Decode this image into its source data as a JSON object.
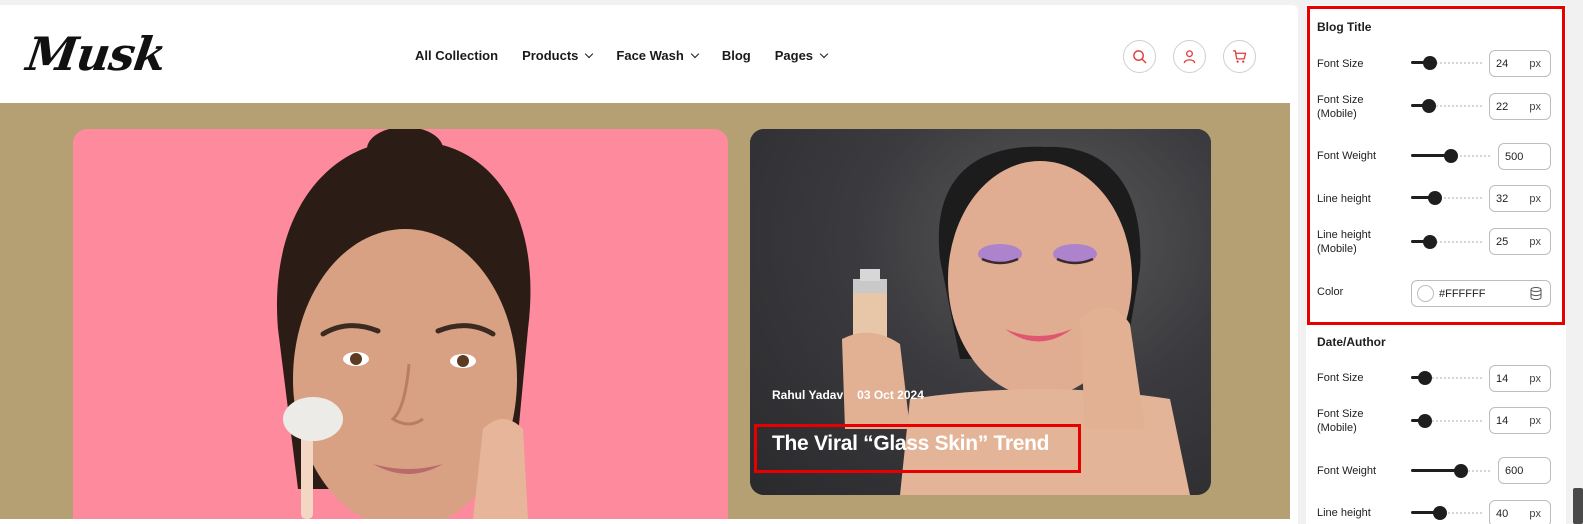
{
  "site": {
    "logo": "Musk",
    "nav": [
      {
        "label": "All Collection",
        "has_dropdown": false
      },
      {
        "label": "Products",
        "has_dropdown": true
      },
      {
        "label": "Face Wash",
        "has_dropdown": true
      },
      {
        "label": "Blog",
        "has_dropdown": false
      },
      {
        "label": "Pages",
        "has_dropdown": true
      }
    ],
    "header_icons": [
      "search-icon",
      "user-icon",
      "cart-icon"
    ],
    "icon_color": "#e03c3c"
  },
  "blog": {
    "featured_post": {
      "author": "Rahul Yadav",
      "date": "03 Oct 2024",
      "title": "The Viral “Glass Skin” Trend"
    },
    "band_color": "#b5a074",
    "card1_color": "#fe8a9d"
  },
  "settings": {
    "blog_title": {
      "heading": "Blog Title",
      "font_size": {
        "label": "Font Size",
        "value": "24",
        "unit": "px",
        "level": 0.27
      },
      "font_size_mobile": {
        "label": "Font Size (Mobile)",
        "value": "22",
        "unit": "px",
        "level": 0.25
      },
      "font_weight": {
        "label": "Font Weight",
        "value": "500",
        "level": 0.5
      },
      "line_height": {
        "label": "Line height",
        "value": "32",
        "unit": "px",
        "level": 0.33
      },
      "line_height_mobile": {
        "label": "Line height (Mobile)",
        "value": "25",
        "unit": "px",
        "level": 0.27
      },
      "color": {
        "label": "Color",
        "value": "#FFFFFF"
      }
    },
    "date_author": {
      "heading": "Date/Author",
      "font_size": {
        "label": "Font Size",
        "value": "14",
        "unit": "px",
        "level": 0.19
      },
      "font_size_mobile": {
        "label": "Font Size (Mobile)",
        "value": "14",
        "unit": "px",
        "level": 0.19
      },
      "font_weight": {
        "label": "Font Weight",
        "value": "600",
        "level": 0.62
      },
      "line_height": {
        "label": "Line height",
        "value": "40",
        "unit": "px",
        "level": 0.4
      }
    },
    "highlight_color": "#e60000"
  }
}
